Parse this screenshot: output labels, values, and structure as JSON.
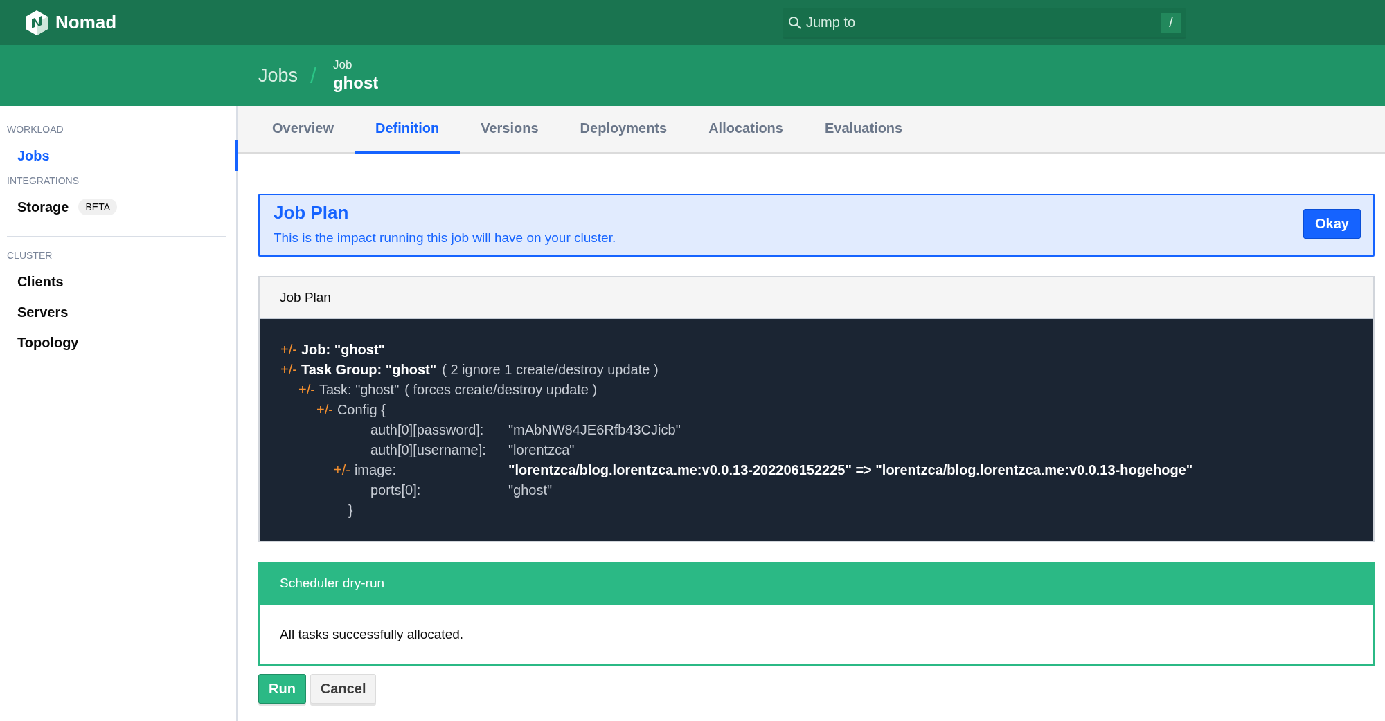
{
  "header": {
    "brand": "Nomad",
    "search": {
      "placeholder": "Jump to",
      "shortcut": "/"
    }
  },
  "breadcrumbs": {
    "parent": "Jobs",
    "separator": "/",
    "label": "Job",
    "current": "ghost"
  },
  "sidebar": {
    "sections": [
      {
        "heading": "WORKLOAD",
        "items": [
          {
            "label": "Jobs",
            "selected": true
          }
        ]
      },
      {
        "heading": "INTEGRATIONS",
        "items": [
          {
            "label": "Storage",
            "badge": "BETA",
            "selected": false
          }
        ]
      },
      {
        "heading": "CLUSTER",
        "items": [
          {
            "label": "Clients",
            "selected": false
          },
          {
            "label": "Servers",
            "selected": false
          },
          {
            "label": "Topology",
            "selected": false
          }
        ]
      }
    ]
  },
  "tabs": [
    {
      "label": "Overview",
      "selected": false
    },
    {
      "label": "Definition",
      "selected": true
    },
    {
      "label": "Versions",
      "selected": false
    },
    {
      "label": "Deployments",
      "selected": false
    },
    {
      "label": "Allocations",
      "selected": false
    },
    {
      "label": "Evaluations",
      "selected": false
    }
  ],
  "notice": {
    "title": "Job Plan",
    "message": "This is the impact running this job will have on your cluster.",
    "button": "Okay"
  },
  "plan": {
    "title": "Job Plan",
    "diff": [
      {
        "kind": "job",
        "marker": "+/-",
        "text": "Job: \"ghost\"",
        "children": [
          {
            "kind": "group",
            "marker": "+/-",
            "text": "Task Group: \"ghost\"",
            "note": "( 2 ignore 1 create/destroy update )",
            "children": [
              {
                "kind": "task",
                "marker": "+/-",
                "text": "Task: \"ghost\"",
                "note": "( forces create/destroy update )",
                "children": [
                  {
                    "kind": "object",
                    "marker": "+/-",
                    "text": "Config {",
                    "close": "}",
                    "children": [
                      {
                        "kind": "field",
                        "name": "auth[0][password]:",
                        "value": "\"mAbNW84JE6Rfb43CJicb\"",
                        "changed": false
                      },
                      {
                        "kind": "field",
                        "name": "auth[0][username]:",
                        "value": "\"lorentzca\"",
                        "changed": false
                      },
                      {
                        "kind": "field",
                        "marker": "+/-",
                        "name": "image:",
                        "value": "\"lorentzca/blog.lorentzca.me:v0.0.13-202206152225\" => \"lorentzca/blog.lorentzca.me:v0.0.13-hogehoge\"",
                        "changed": true
                      },
                      {
                        "kind": "field",
                        "name": "ports[0]:",
                        "value": "\"ghost\"",
                        "changed": false
                      }
                    ]
                  }
                ]
              }
            ]
          }
        ]
      }
    ]
  },
  "dry_run": {
    "title": "Scheduler dry-run",
    "message": "All tasks successfully allocated."
  },
  "actions": [
    {
      "label": "Run",
      "kind": "primary"
    },
    {
      "label": "Cancel",
      "kind": "secondary"
    }
  ]
}
